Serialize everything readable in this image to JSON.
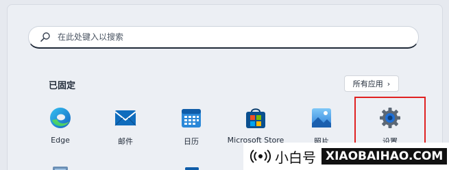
{
  "search": {
    "placeholder": "在此处键入以搜索",
    "icon": "search-icon"
  },
  "pinned": {
    "title": "已固定",
    "all_apps_label": "所有应用",
    "all_apps_chevron": "›"
  },
  "apps": [
    {
      "label": "Edge",
      "icon": "edge-icon"
    },
    {
      "label": "邮件",
      "icon": "mail-icon"
    },
    {
      "label": "日历",
      "icon": "calendar-icon"
    },
    {
      "label": "Microsoft Store",
      "icon": "store-icon"
    },
    {
      "label": "照片",
      "icon": "photos-icon"
    },
    {
      "label": "设置",
      "icon": "settings-icon"
    }
  ],
  "watermark": {
    "text": "小白号",
    "url": "XIAOBAIHAO.COM"
  },
  "colors": {
    "highlight": "#e02020",
    "accent": "#0067c0"
  }
}
